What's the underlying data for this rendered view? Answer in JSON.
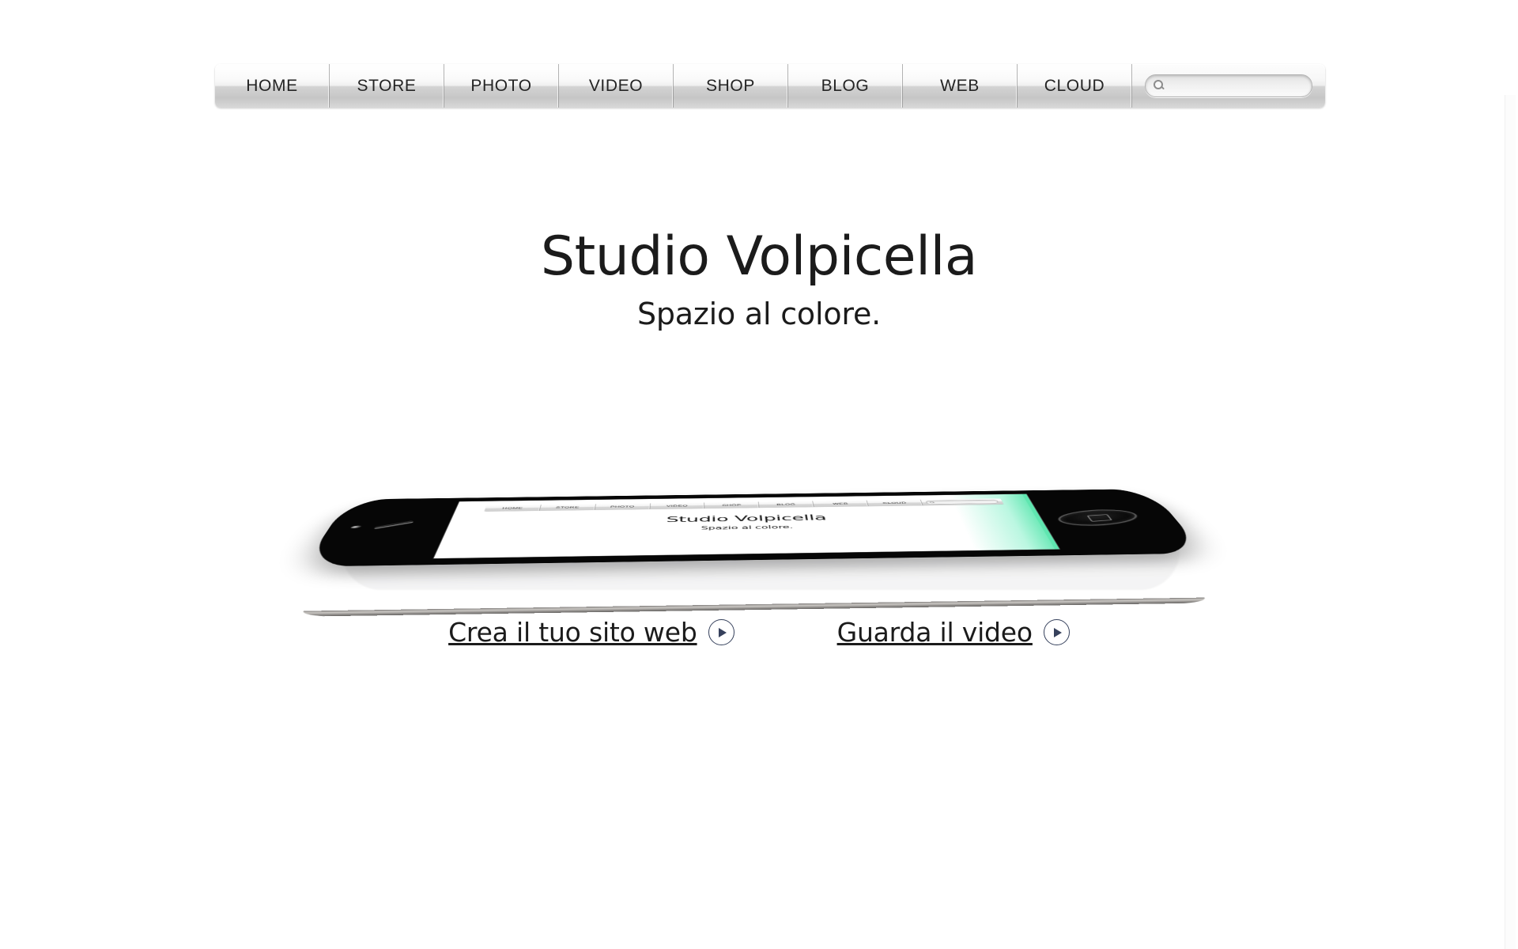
{
  "site": {
    "title": "Studio Volpicella",
    "tagline": "Spazio al colore."
  },
  "nav": {
    "items": [
      {
        "label": "HOME"
      },
      {
        "label": "STORE"
      },
      {
        "label": "PHOTO"
      },
      {
        "label": "VIDEO"
      },
      {
        "label": "SHOP"
      },
      {
        "label": "BLOG"
      },
      {
        "label": "WEB"
      },
      {
        "label": "CLOUD"
      }
    ],
    "search": {
      "icon": "search-icon",
      "value": "",
      "placeholder": ""
    }
  },
  "hero": {
    "title": "Studio Volpicella",
    "subtitle": "Spazio al colore."
  },
  "device": {
    "type": "smartphone-landscape",
    "screen": {
      "nav_items": [
        "HOME",
        "STORE",
        "PHOTO",
        "VIDEO",
        "SHOP",
        "BLOG",
        "WEB",
        "CLOUD"
      ],
      "search_icon": "search-icon",
      "title": "Studio Volpicella",
      "subtitle": "Spazio al colore."
    },
    "hardware": {
      "speaker": "earpiece-speaker",
      "camera": "front-camera",
      "home_button": "home-button"
    },
    "glow_color": "#5fe6b0"
  },
  "cta": [
    {
      "label": "Crea il tuo sito web",
      "icon": "play-circle-icon"
    },
    {
      "label": "Guarda il video",
      "icon": "play-circle-icon"
    }
  ],
  "colors": {
    "background": "#ffffff",
    "text": "#1b1b1b",
    "nav_text": "#242424",
    "accent_glow": "#5fe6b0",
    "play_icon": "#36415c"
  }
}
